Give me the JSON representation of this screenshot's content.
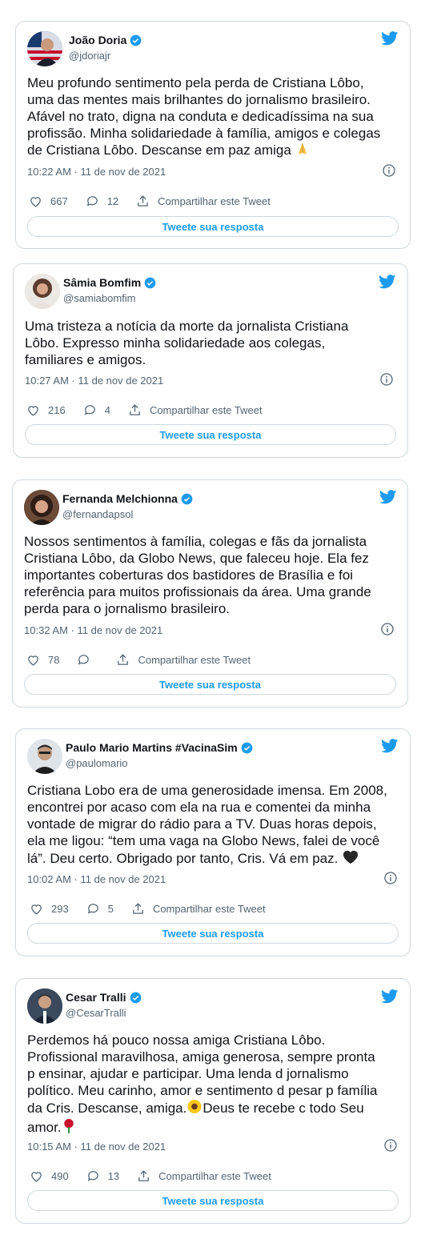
{
  "tweets": [
    {
      "name": "João Doria",
      "handle": "@jdoriajr",
      "lines": [
        "Meu profundo sentimento pela perda de Cristiana Lôbo,",
        "uma das mentes mais brilhantes do jornalismo brasileiro.",
        "Afável no trato, digna na conduta e dedicadíssima na sua",
        "profissão. Minha solidariedade à família, amigos e colegas",
        "de Cristiana Lôbo. Descanse em paz amiga"
      ],
      "emoji": "folded-hands",
      "timestamp": "10:22 AM · 11 de nov de 2021",
      "likes": "667",
      "replies": "12",
      "share_label": "Compartilhar este Tweet",
      "reply_button": "Tweete sua resposta"
    },
    {
      "name": "Sâmia Bomfim",
      "handle": "@samiabomfim",
      "lines": [
        "Uma tristeza a notícia da morte da jornalista Cristiana",
        "Lôbo. Expresso minha solidariedade aos colegas,",
        "familiares e amigos."
      ],
      "timestamp": "10:27 AM · 11 de nov de 2021",
      "likes": "216",
      "replies": "4",
      "share_label": "Compartilhar este Tweet",
      "reply_button": "Tweete sua resposta"
    },
    {
      "name": "Fernanda Melchionna",
      "handle": "@fernandapsol",
      "lines": [
        "Nossos sentimentos à família, colegas e fãs da jornalista",
        "Cristiana Lôbo, da Globo News, que faleceu hoje. Ela fez",
        "importantes coberturas dos bastidores de Brasília e foi",
        "referência para muitos profissionais da área. Uma grande",
        "perda para o jornalismo brasileiro."
      ],
      "timestamp": "10:32 AM · 11 de nov de 2021",
      "likes": "78",
      "replies": "",
      "share_label": "Compartilhar este Tweet",
      "reply_button": "Tweete sua resposta"
    },
    {
      "name": "Paulo Mario Martins #VacinaSim",
      "handle": "@paulomario",
      "lines": [
        "Cristiana Lobo era de uma generosidade imensa. Em 2008,",
        "encontrei por acaso com ela na rua e comentei da minha",
        "vontade de migrar do rádio para a TV. Duas horas depois,",
        "ela me ligou: “tem uma vaga na Globo News, falei de você",
        "lá”. Deu certo. Obrigado por tanto, Cris. Vá em paz."
      ],
      "emoji": "black-heart",
      "timestamp": "10:02 AM · 11 de nov de 2021",
      "likes": "293",
      "replies": "5",
      "share_label": "Compartilhar este Tweet",
      "reply_button": "Tweete sua resposta"
    },
    {
      "name": "Cesar Tralli",
      "handle": "@CesarTralli",
      "lines": [
        "Perdemos há pouco nossa amiga Cristiana Lôbo.",
        "Profissional maravilhosa, amiga generosa, sempre pronta",
        "p ensinar, ajudar e participar. Uma lenda d jornalismo",
        "político. Meu carinho, amor e sentimento d pesar p família",
        "da Cris. Descanse, amiga.",
        "amor."
      ],
      "line5_suffix": "Deus te recebe c todo Seu",
      "emoji_mid": "sunflower",
      "emoji": "rose",
      "timestamp": "10:15 AM · 11 de nov de 2021",
      "likes": "490",
      "replies": "13",
      "share_label": "Compartilhar este Tweet",
      "reply_button": "Tweete sua resposta"
    }
  ],
  "colors": {
    "accent": "#1d9bf0",
    "text": "#0f1419",
    "muted": "#536471",
    "border": "#cfd9de"
  }
}
